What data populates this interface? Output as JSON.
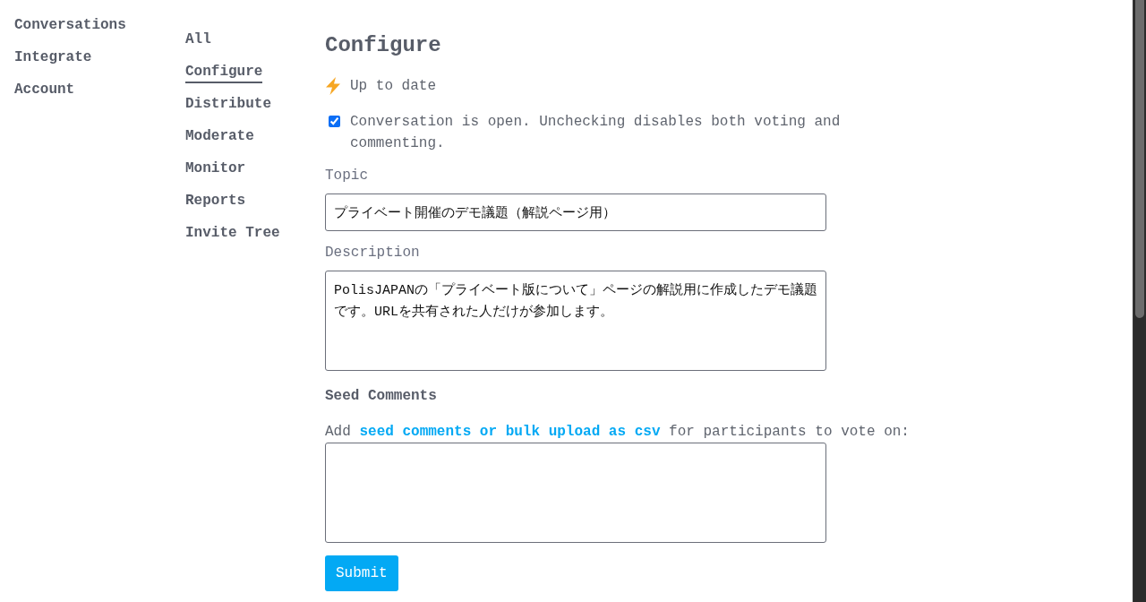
{
  "main_nav": {
    "items": [
      "Conversations",
      "Integrate",
      "Account"
    ]
  },
  "sub_nav": {
    "items": [
      {
        "label": "All",
        "selected": false
      },
      {
        "label": "Configure",
        "selected": true
      },
      {
        "label": "Distribute",
        "selected": false
      },
      {
        "label": "Moderate",
        "selected": false
      },
      {
        "label": "Monitor",
        "selected": false
      },
      {
        "label": "Reports",
        "selected": false
      },
      {
        "label": "Invite Tree",
        "selected": false
      }
    ]
  },
  "page": {
    "title": "Configure"
  },
  "sync_status": {
    "text": "Up to date"
  },
  "open_setting": {
    "label": "Conversation is open. Unchecking disables both voting and commenting.",
    "checked": true
  },
  "topic": {
    "label": "Topic",
    "value": "プライベート開催のデモ議題（解説ページ用）"
  },
  "description": {
    "label": "Description",
    "value": "PolisJAPANの「プライベート版について」ページの解説用に作成したデモ議題です。URLを共有された人だけが参加します。"
  },
  "seed_comments": {
    "heading": "Seed Comments",
    "instruction": {
      "before": "Add",
      "link": "seed comments or bulk upload as csv",
      "after": "for participants to vote on:"
    },
    "submit_label": "Submit"
  }
}
